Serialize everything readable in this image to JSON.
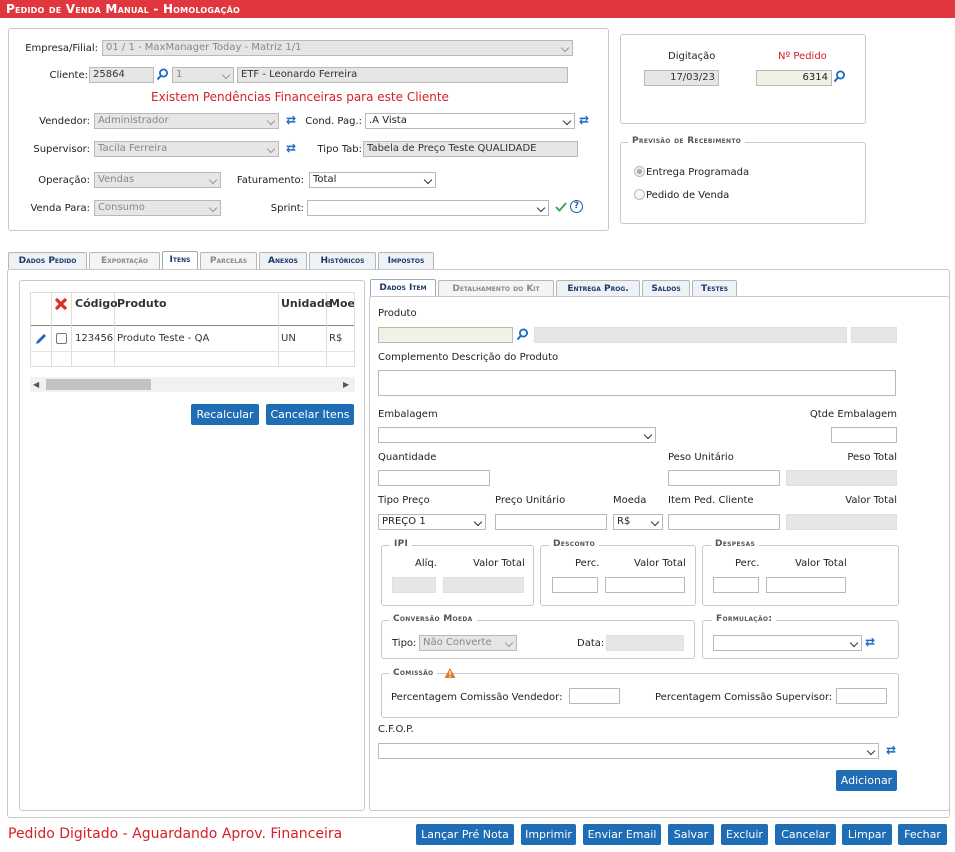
{
  "title": "Pedido de Venda Manual - Homologação",
  "header": {
    "empresa_label": "Empresa/Filial:",
    "empresa_value": "01 / 1 - MaxManager Today - Matriz 1/1",
    "cliente_label": "Cliente:",
    "cliente_code": "25864",
    "cliente_seq": "1",
    "cliente_name": "ETF - Leonardo Ferreira",
    "alert": "Existem Pendências Financeiras para este Cliente",
    "vendedor_label": "Vendedor:",
    "vendedor_value": "Administrador",
    "cond_label": "Cond. Pag.:",
    "cond_value": ".A Vista",
    "supervisor_label": "Supervisor:",
    "supervisor_value": "Tacila Ferreira",
    "tipotab_label": "Tipo Tab:",
    "tipotab_value": "Tabela de Preço Teste QUALIDADE",
    "operacao_label": "Operação:",
    "operacao_value": "Vendas",
    "faturamento_label": "Faturamento:",
    "faturamento_value": "Total",
    "vendapara_label": "Venda Para:",
    "vendapara_value": "Consumo",
    "sprint_label": "Sprint:",
    "sprint_value": ""
  },
  "order": {
    "digitacao_label": "Digitação",
    "digitacao_value": "17/03/23",
    "pedido_label": "Nº Pedido",
    "pedido_value": "6314"
  },
  "previsao": {
    "title": "Previsão de Recebimento",
    "opt1": "Entrega Programada",
    "opt2": "Pedido de Venda"
  },
  "tabs": [
    "Dados Pedido",
    "Exportação",
    "Itens",
    "Parcelas",
    "Anexos",
    "Históricos",
    "Impostos"
  ],
  "items_table": {
    "headers": [
      "Código",
      "Produto",
      "Unidade",
      "Moed"
    ],
    "rows": [
      {
        "codigo": "123456",
        "produto": "Produto Teste - QA",
        "unidade": "UN",
        "moeda": "R$"
      }
    ]
  },
  "left_buttons": {
    "recalcular": "Recalcular",
    "cancelar": "Cancelar Itens"
  },
  "subtabs": [
    "Dados Item",
    "Detalhamento do Kit",
    "Entrega Prog.",
    "Saldos",
    "Testes"
  ],
  "item_form": {
    "produto_label": "Produto",
    "complemento_label": "Complemento Descrição do Produto",
    "embalagem_label": "Embalagem",
    "qtde_emb_label": "Qtde Embalagem",
    "quantidade_label": "Quantidade",
    "peso_unit_label": "Peso Unitário",
    "peso_total_label": "Peso Total",
    "tipo_preco_label": "Tipo Preço",
    "tipo_preco_value": "PREÇO 1",
    "preco_unit_label": "Preço Unitário",
    "moeda_label": "Moeda",
    "moeda_value": "R$",
    "item_ped_label": "Item Ped. Cliente",
    "valor_total_label": "Valor Total",
    "ipi_title": "IPI",
    "aliq_label": "Alíq.",
    "ipi_valor_label": "Valor Total",
    "desconto_title": "Desconto",
    "desc_perc_label": "Perc.",
    "desc_valor_label": "Valor Total",
    "despesas_title": "Despesas",
    "desp_perc_label": "Perc.",
    "desp_valor_label": "Valor Total",
    "conversao_title": "Conversão Moeda",
    "tipo_label": "Tipo:",
    "tipo_value": "Não Converte",
    "data_label": "Data:",
    "formulacao_title": "Formulação:",
    "comissao_title": "Comissão",
    "com_vend_label": "Percentagem Comissão Vendedor:",
    "com_sup_label": "Percentagem Comissão Supervisor:",
    "cfop_label": "C.F.O.P.",
    "adicionar": "Adicionar"
  },
  "footer": {
    "status": "Pedido Digitado - Aguardando Aprov. Financeira",
    "buttons": [
      "Lançar Pré Nota",
      "Imprimir",
      "Enviar Email",
      "Salvar",
      "Excluir",
      "Cancelar",
      "Limpar",
      "Fechar"
    ]
  },
  "colors": {
    "accent": "#1f6db5",
    "title_bar": "#e0373f",
    "alert": "#d61f26"
  }
}
